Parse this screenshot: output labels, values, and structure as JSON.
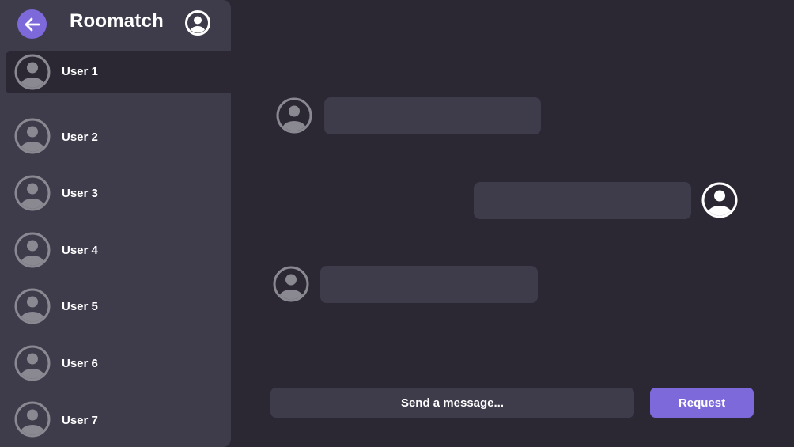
{
  "app": {
    "title": "Roomatch"
  },
  "icons": {
    "back": "arrow-left-icon",
    "profile": "user-circle-icon",
    "avatar": "user-avatar-icon"
  },
  "colors": {
    "accent": "#7d69da",
    "background": "#2b2834",
    "panel": "#3e3b4b",
    "avatar_gray": "#8a8890",
    "text": "#ffffff"
  },
  "sidebar": {
    "users": [
      {
        "name": "User 1",
        "active": true
      },
      {
        "name": "User 2",
        "active": false
      },
      {
        "name": "User 3",
        "active": false
      },
      {
        "name": "User 4",
        "active": false
      },
      {
        "name": "User 5",
        "active": false
      },
      {
        "name": "User 6",
        "active": false
      },
      {
        "name": "User 7",
        "active": false
      }
    ]
  },
  "chat": {
    "messages": [
      {
        "sender": "other",
        "text": ""
      },
      {
        "sender": "self",
        "text": ""
      },
      {
        "sender": "other",
        "text": ""
      }
    ],
    "composer_placeholder": "Send a message...",
    "request_label": "Request"
  }
}
